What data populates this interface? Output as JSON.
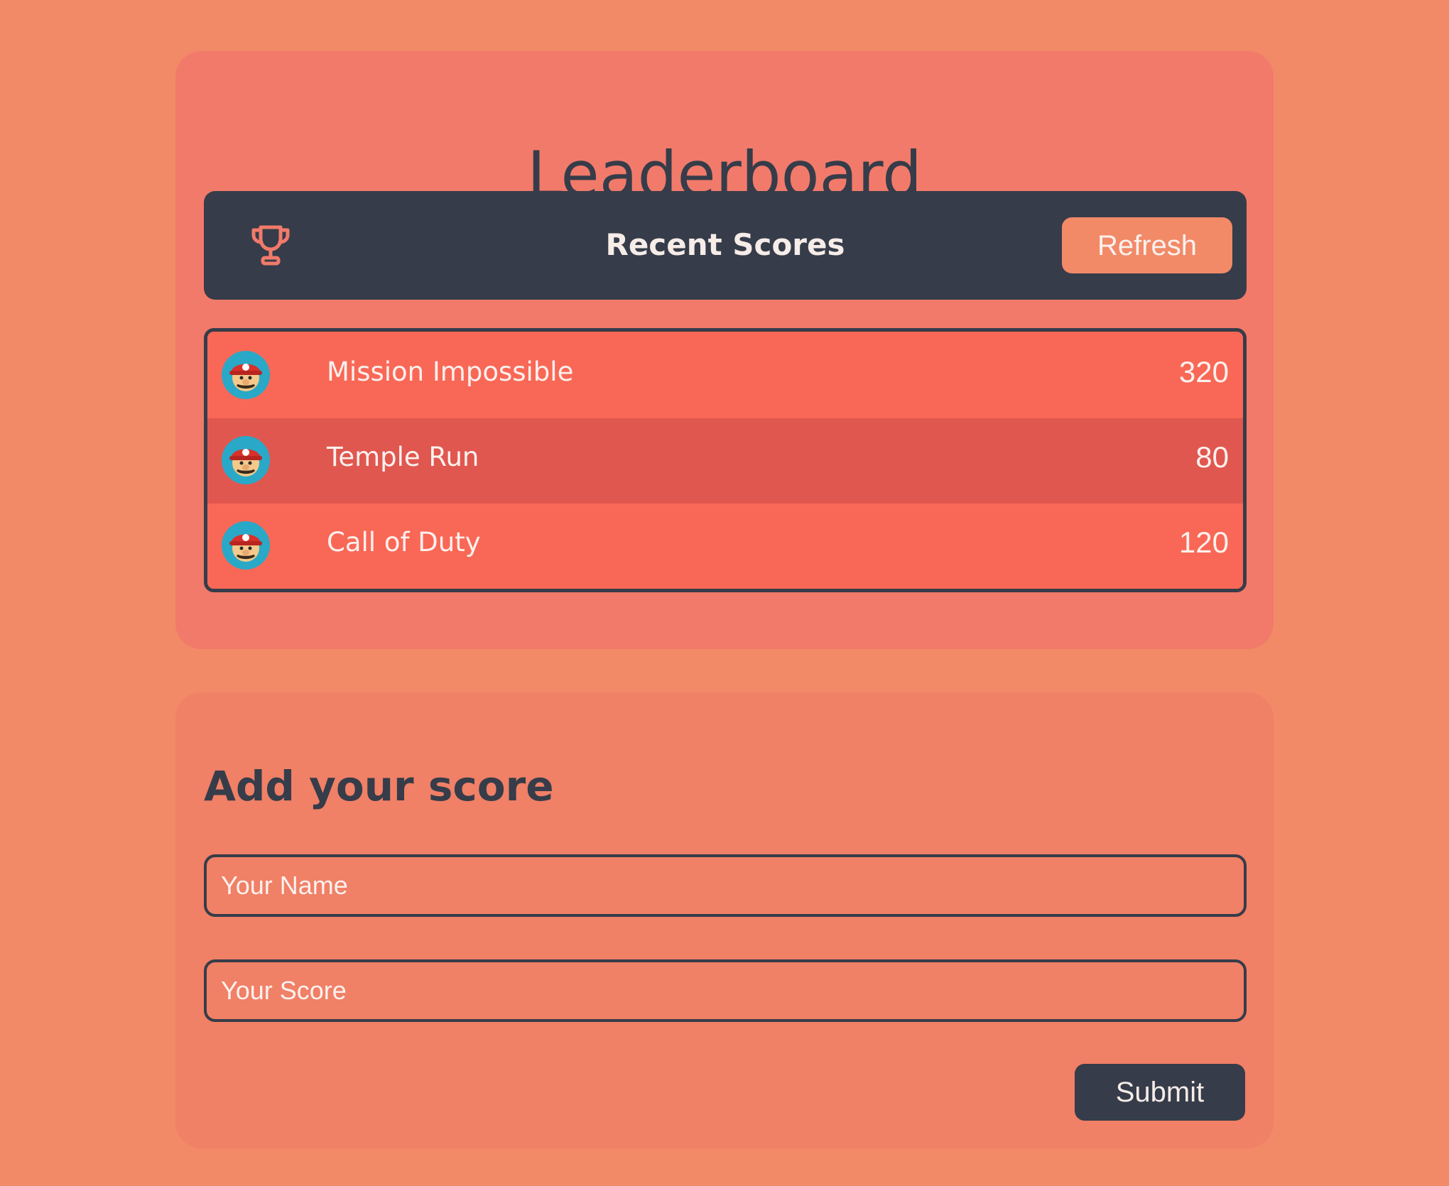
{
  "leaderboard": {
    "title": "Leaderboard",
    "header": {
      "icon": "trophy-icon",
      "title": "Recent Scores",
      "refresh_label": "Refresh"
    },
    "scores": [
      {
        "avatar": "mario-avatar",
        "name": "Mission Impossible",
        "score": "320"
      },
      {
        "avatar": "mario-avatar",
        "name": "Temple Run",
        "score": "80"
      },
      {
        "avatar": "mario-avatar",
        "name": "Call of Duty",
        "score": "120"
      }
    ]
  },
  "form": {
    "title": "Add your score",
    "name_placeholder": "Your Name",
    "score_placeholder": "Your Score",
    "submit_label": "Submit"
  },
  "colors": {
    "page_background": "#f28a68",
    "card_background": "#f27a6a",
    "dark": "#363c49",
    "row_odd": "#f96856",
    "row_even": "#e0574f",
    "accent": "#f28a68"
  }
}
